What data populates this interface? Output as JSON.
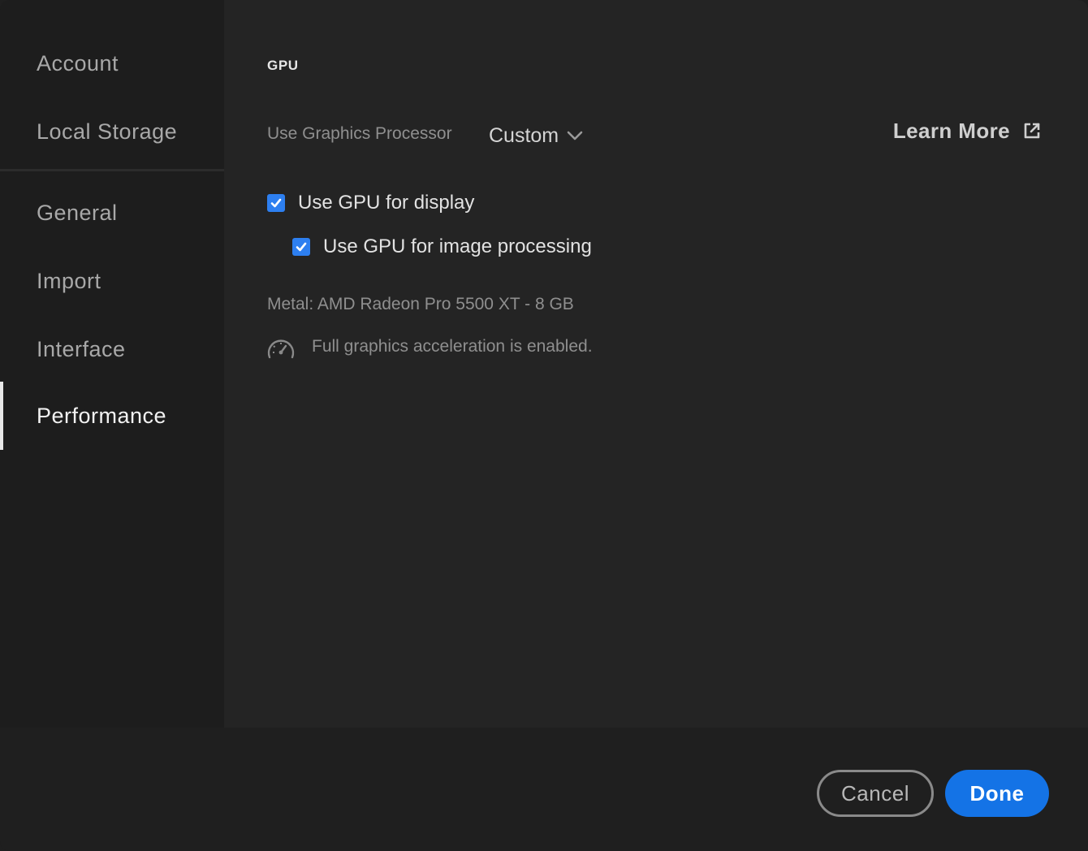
{
  "sidebar": {
    "items_top": [
      {
        "label": "Account"
      },
      {
        "label": "Local Storage"
      }
    ],
    "items": [
      {
        "label": "General"
      },
      {
        "label": "Import"
      },
      {
        "label": "Interface"
      },
      {
        "label": "Performance",
        "active": true
      }
    ]
  },
  "content": {
    "section_title": "GPU",
    "use_graphics_processor_label": "Use Graphics Processor",
    "graphics_processor_value": "Custom",
    "learn_more_label": "Learn More",
    "checkboxes": [
      {
        "label": "Use GPU for display",
        "checked": true
      },
      {
        "label": "Use GPU for image processing",
        "checked": true
      }
    ],
    "gpu_info": "Metal: AMD Radeon Pro 5500 XT - 8 GB",
    "acceleration_status": "Full graphics acceleration is enabled."
  },
  "footer": {
    "cancel_label": "Cancel",
    "done_label": "Done"
  },
  "colors": {
    "accent": "#1473e6",
    "checkbox": "#2d7ff0",
    "background": "#242424",
    "sidebar": "#1d1d1d"
  },
  "icons": {
    "dropdown": "chevron-down-icon",
    "external": "external-link-icon",
    "check": "checkmark-icon",
    "gauge": "speedometer-icon"
  }
}
